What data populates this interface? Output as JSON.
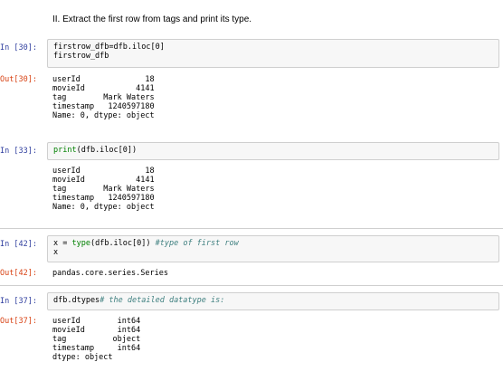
{
  "markdown": {
    "heading": "II. Extract the first row from tags and print its type."
  },
  "cells": {
    "c30": {
      "in_prompt": "In [30]:",
      "code_line1": "firstrow_dfb=dfb.iloc[0]",
      "code_line2": "firstrow_dfb",
      "out_prompt": "Out[30]:",
      "output": "userId              18\nmovieId           4141\ntag        Mark Waters\ntimestamp   1240597180\nName: 0, dtype: object"
    },
    "c33": {
      "in_prompt": "In [33]:",
      "code_print": "print",
      "code_rest": "(dfb.iloc[0])",
      "output": "userId              18\nmovieId           4141\ntag        Mark Waters\ntimestamp   1240597180\nName: 0, dtype: object"
    },
    "c42": {
      "in_prompt": "In [42]:",
      "code_a": "x = ",
      "code_type": "type",
      "code_b": "(dfb.iloc[0]) ",
      "code_comment": "#type of first row",
      "code_line2": "x",
      "out_prompt": "Out[42]:",
      "output": "pandas.core.series.Series"
    },
    "c37": {
      "in_prompt": "In [37]:",
      "code": "dfb.dtypes",
      "code_comment": "# the detailed datatype is:",
      "out_prompt": "Out[37]:",
      "output": "userId        int64\nmovieId       int64\ntag          object\ntimestamp     int64\ndtype: object"
    }
  }
}
